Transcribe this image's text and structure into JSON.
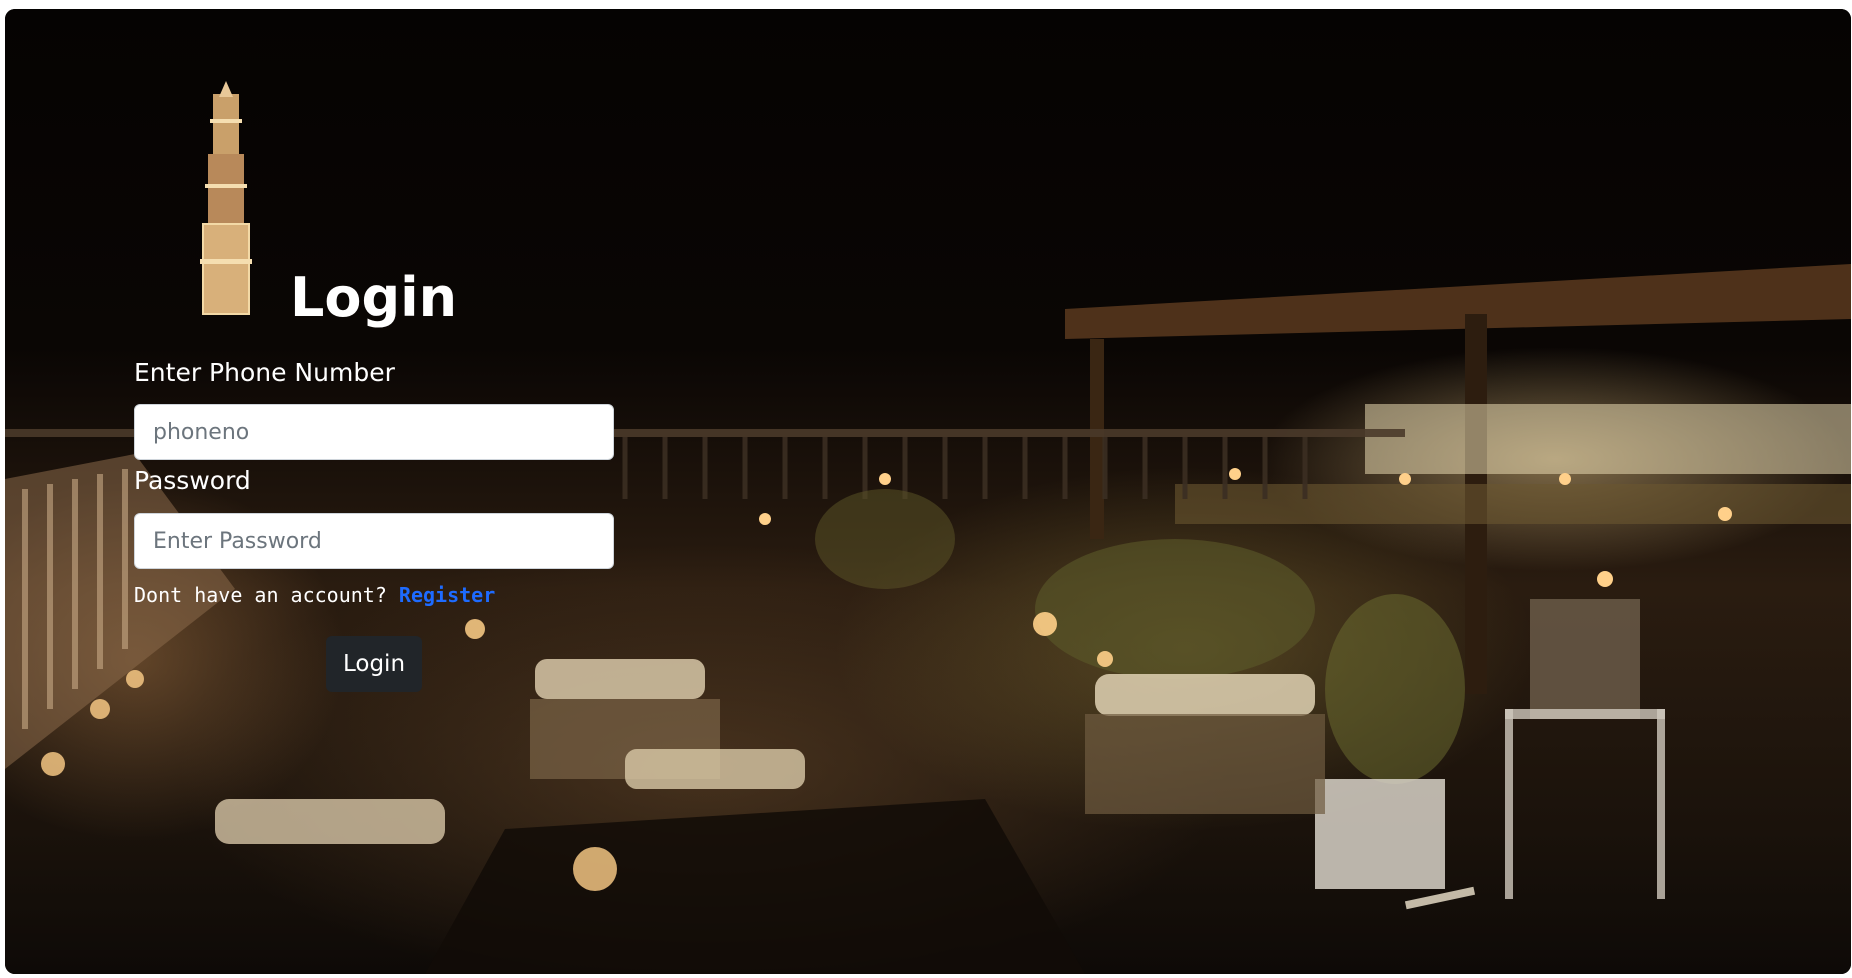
{
  "page": {
    "title": "Login"
  },
  "form": {
    "phone_label": "Enter Phone Number",
    "phone_placeholder": "phoneno",
    "password_label": "Password",
    "password_placeholder": "Enter Password",
    "account_prompt": "Dont have an account? ",
    "register_link": "Register",
    "login_button": "Login"
  },
  "colors": {
    "register_link": "#1e6bff",
    "login_button_bg": "#212529",
    "text": "#ffffff"
  },
  "images": {
    "background": "night-rooftop-restaurant-photo",
    "tower": "illuminated-minaret-tower"
  }
}
